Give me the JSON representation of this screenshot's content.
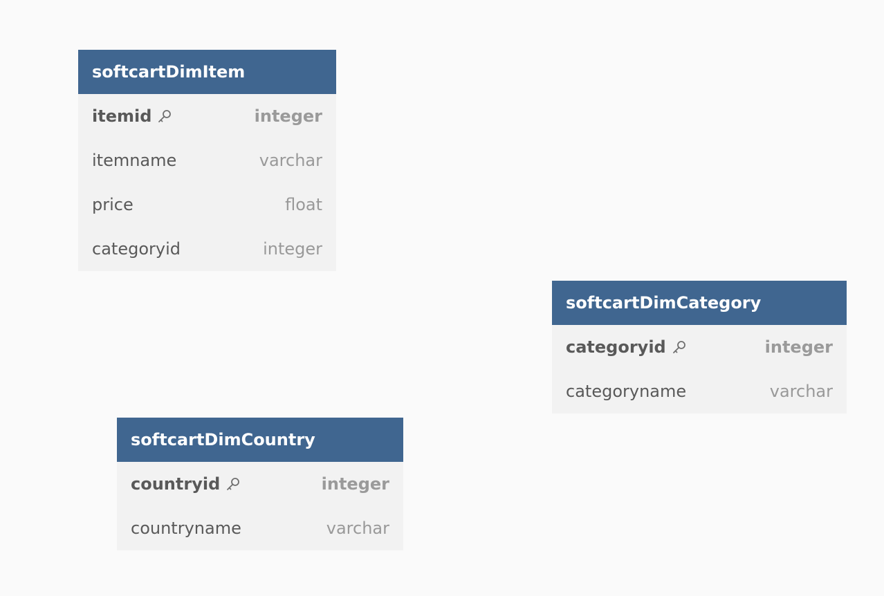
{
  "tables": [
    {
      "name": "softcartDimItem",
      "columns": [
        {
          "name": "itemid",
          "type": "integer",
          "primary_key": true
        },
        {
          "name": "itemname",
          "type": "varchar",
          "primary_key": false
        },
        {
          "name": "price",
          "type": "float",
          "primary_key": false
        },
        {
          "name": "categoryid",
          "type": "integer",
          "primary_key": false
        }
      ]
    },
    {
      "name": "softcartDimCategory",
      "columns": [
        {
          "name": "categoryid",
          "type": "integer",
          "primary_key": true
        },
        {
          "name": "categoryname",
          "type": "varchar",
          "primary_key": false
        }
      ]
    },
    {
      "name": "softcartDimCountry",
      "columns": [
        {
          "name": "countryid",
          "type": "integer",
          "primary_key": true
        },
        {
          "name": "countryname",
          "type": "varchar",
          "primary_key": false
        }
      ]
    }
  ],
  "icons": {
    "primary_key": "key-icon"
  },
  "colors": {
    "header_bg": "#406690",
    "row_bg": "#f2f2f2",
    "canvas_bg": "#fafafa"
  }
}
